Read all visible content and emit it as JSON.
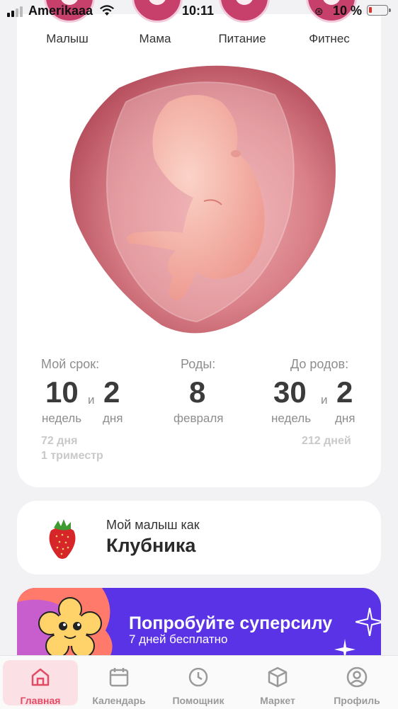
{
  "status_bar": {
    "carrier": "Amerikaaa",
    "time": "10:11",
    "battery": "10 %"
  },
  "categories": [
    {
      "label": "Малыш"
    },
    {
      "label": "Мама"
    },
    {
      "label": "Питание"
    },
    {
      "label": "Фитнес"
    }
  ],
  "pregnancy": {
    "term_label": "Мой срок:",
    "term_weeks": "10",
    "term_and": "и",
    "term_days": "2",
    "term_weeks_unit": "недель",
    "term_days_unit": "дня",
    "term_total_days": "72 дня",
    "trimester": "1 триместр",
    "birth_label": "Роды:",
    "birth_day": "8",
    "birth_month": "февраля",
    "left_label": "До родов:",
    "left_weeks": "30",
    "left_and": "и",
    "left_days": "2",
    "left_weeks_unit": "недель",
    "left_days_unit": "дня",
    "left_total_days": "212 дней"
  },
  "fruit_card": {
    "caption": "Мой малыш как",
    "name": "Клубника"
  },
  "promo": {
    "title": "Попробуйте суперсилу",
    "subtitle": "7 дней бесплатно"
  },
  "tabs": [
    {
      "label": "Главная",
      "icon": "home-icon"
    },
    {
      "label": "Календарь",
      "icon": "calendar-icon"
    },
    {
      "label": "Помощник",
      "icon": "clock-icon"
    },
    {
      "label": "Маркет",
      "icon": "box-icon"
    },
    {
      "label": "Профиль",
      "icon": "profile-icon"
    }
  ],
  "colors": {
    "accent": "#e24b64",
    "promo_bg": "#5a33e6",
    "category_circle": "#c73f6b"
  }
}
